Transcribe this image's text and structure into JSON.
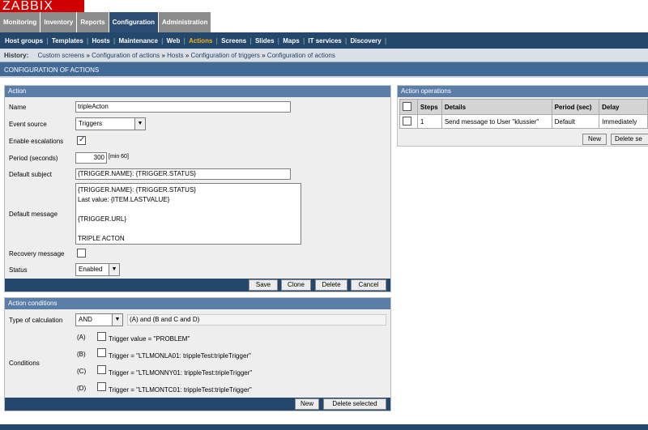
{
  "logo": "ZABBIX",
  "tabs": [
    "Monitoring",
    "Inventory",
    "Reports",
    "Configuration",
    "Administration"
  ],
  "menu": [
    "Host groups",
    "Templates",
    "Hosts",
    "Maintenance",
    "Web",
    "Actions",
    "Screens",
    "Slides",
    "Maps",
    "IT services",
    "Discovery"
  ],
  "history": {
    "label": "History:",
    "items": [
      "Custom screens",
      "Configuration of actions",
      "Hosts",
      "Configuration of triggers",
      "Configuration of actions"
    ]
  },
  "page_title": "CONFIGURATION OF ACTIONS",
  "action": {
    "header": "Action",
    "name_label": "Name",
    "name_value": "tripleActon",
    "event_source_label": "Event source",
    "event_source_value": "Triggers",
    "enable_escalations_label": "Enable escalations",
    "enable_escalations_checked": true,
    "period_label": "Period (seconds)",
    "period_value": "300",
    "period_hint": "[min 60]",
    "default_subject_label": "Default subject",
    "default_subject_value": "{TRIGGER.NAME}: {TRIGGER.STATUS}",
    "default_message_label": "Default message",
    "default_message_lines": [
      "{TRIGGER.NAME}: {TRIGGER.STATUS}",
      "Last value: {ITEM.LASTVALUE}",
      "",
      "{TRIGGER.URL}",
      "",
      "TRIPLE ACTON"
    ],
    "recovery_message_label": "Recovery message",
    "status_label": "Status",
    "status_value": "Enabled",
    "buttons": {
      "save": "Save",
      "clone": "Clone",
      "delete": "Delete",
      "cancel": "Cancel"
    }
  },
  "conditions": {
    "header": "Action conditions",
    "type_label": "Type of calculation",
    "type_value": "AND",
    "formula": "(A) and (B and C and D)",
    "conditions_label": "Conditions",
    "items": [
      {
        "letter": "(A)",
        "text": "Trigger value = \"PROBLEM\""
      },
      {
        "letter": "(B)",
        "text": "Trigger = \"LTLMONLA01: trippleTest:tripleTrigger\""
      },
      {
        "letter": "(C)",
        "text": "Trigger = \"LTLMONNY01: trippleTest:tripleTrigger\""
      },
      {
        "letter": "(D)",
        "text": "Trigger = \"LTLMONTC01: trippleTest:tripleTrigger\""
      }
    ],
    "buttons": {
      "new": "New",
      "delete_selected": "Delete selected"
    }
  },
  "operations": {
    "header": "Action operations",
    "columns": [
      "Steps",
      "Details",
      "Period (sec)",
      "Delay"
    ],
    "rows": [
      {
        "steps": "1",
        "details": "Send message to User \"klussier\"",
        "period": "Default",
        "delay": "Immediately"
      }
    ],
    "buttons": {
      "new": "New",
      "delete_selected": "Delete se"
    }
  }
}
